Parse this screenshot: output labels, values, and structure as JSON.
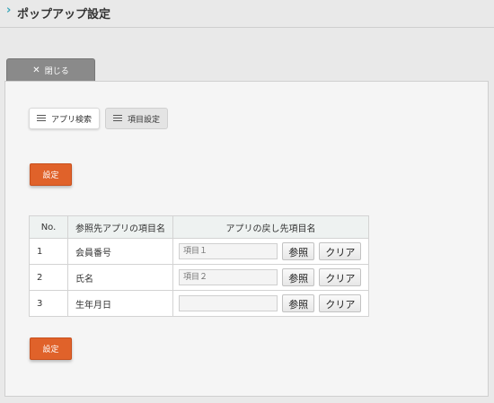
{
  "header": {
    "title": "ポップアップ設定"
  },
  "close_button": {
    "label": "閉じる"
  },
  "tabs": [
    {
      "label": "アプリ検索",
      "active": true
    },
    {
      "label": "項目設定",
      "active": false
    }
  ],
  "buttons": {
    "set_top": "設定",
    "set_bottom": "設定"
  },
  "table": {
    "headers": [
      "No.",
      "参照先アプリの項目名",
      "アプリの戻し先項目名"
    ],
    "rows": [
      {
        "no": "1",
        "name": "会員番号",
        "placeholder": "項目１",
        "ref": "参照",
        "clear": "クリア"
      },
      {
        "no": "2",
        "name": "氏名",
        "placeholder": "項目２",
        "ref": "参照",
        "clear": "クリア"
      },
      {
        "no": "3",
        "name": "生年月日",
        "placeholder": "",
        "ref": "参照",
        "clear": "クリア"
      }
    ]
  },
  "colors": {
    "primary": "#e0622a",
    "accent": "#3aa6b9",
    "header_bg": "#eef2f1"
  },
  "icons": {
    "header": "chevron-right-icon",
    "close": "close-icon",
    "tab": "list-icon"
  }
}
